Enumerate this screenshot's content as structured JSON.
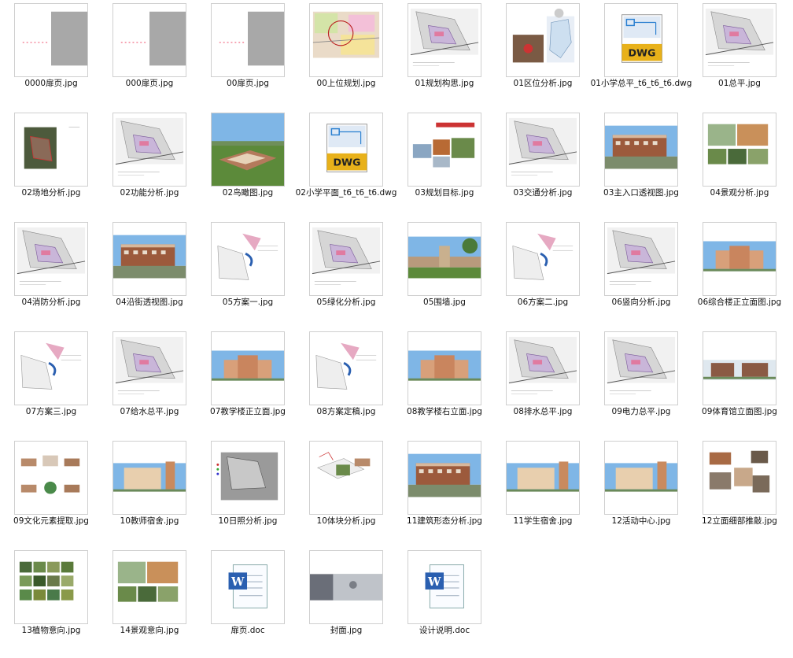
{
  "colors": {
    "thumb_border": "#cfcfcf",
    "gray_block": "#a8a8a8",
    "dwg_gold": "#e8b11a",
    "word_blue": "#2a5fb0",
    "sky": "#7fb6e6",
    "brick": "#9c5a3c",
    "grass": "#5c8a3a"
  },
  "files": [
    {
      "label": "0000扉页.jpg",
      "icon": "title-page-thumb"
    },
    {
      "label": "000扉页.jpg",
      "icon": "title-page-thumb"
    },
    {
      "label": "00扉页.jpg",
      "icon": "title-page-thumb"
    },
    {
      "label": "00上位规划.jpg",
      "icon": "planning-map-thumb"
    },
    {
      "label": "01规划构思.jpg",
      "icon": "site-plan-thumb"
    },
    {
      "label": "01区位分析.jpg",
      "icon": "location-map-thumb"
    },
    {
      "label": "01小学总平_t6_t6_t6.dwg",
      "icon": "dwg-file-icon"
    },
    {
      "label": "01总平.jpg",
      "icon": "site-plan-thumb"
    },
    {
      "label": "02场地分析.jpg",
      "icon": "aerial-photo-thumb"
    },
    {
      "label": "02功能分析.jpg",
      "icon": "site-plan-thumb"
    },
    {
      "label": "02鸟瞰图.jpg",
      "icon": "birdseye-render-thumb"
    },
    {
      "label": "02小学平面_t6_t6_t6.dwg",
      "icon": "dwg-file-icon"
    },
    {
      "label": "03规划目标.jpg",
      "icon": "photo-collage-thumb"
    },
    {
      "label": "03交通分析.jpg",
      "icon": "site-plan-thumb"
    },
    {
      "label": "03主入口透视图.jpg",
      "icon": "building-render-thumb"
    },
    {
      "label": "04景观分析.jpg",
      "icon": "landscape-collage-thumb"
    },
    {
      "label": "04消防分析.jpg",
      "icon": "site-plan-thumb"
    },
    {
      "label": "04沿街透视图.jpg",
      "icon": "building-render-thumb"
    },
    {
      "label": "05方案一.jpg",
      "icon": "scheme-diagram-thumb"
    },
    {
      "label": "05绿化分析.jpg",
      "icon": "site-plan-thumb"
    },
    {
      "label": "05围墙.jpg",
      "icon": "wall-render-thumb"
    },
    {
      "label": "06方案二.jpg",
      "icon": "scheme-diagram-thumb"
    },
    {
      "label": "06竖向分析.jpg",
      "icon": "site-plan-thumb"
    },
    {
      "label": "06综合楼正立面图.jpg",
      "icon": "elevation-thumb"
    },
    {
      "label": "07方案三.jpg",
      "icon": "scheme-diagram-thumb"
    },
    {
      "label": "07给水总平.jpg",
      "icon": "site-plan-thumb"
    },
    {
      "label": "07教学楼正立面.jpg",
      "icon": "elevation-thumb"
    },
    {
      "label": "08方案定稿.jpg",
      "icon": "scheme-diagram-thumb"
    },
    {
      "label": "08教学楼右立面.jpg",
      "icon": "elevation-thumb"
    },
    {
      "label": "08排水总平.jpg",
      "icon": "site-plan-thumb"
    },
    {
      "label": "09电力总平.jpg",
      "icon": "site-plan-thumb"
    },
    {
      "label": "09体育馆立面图.jpg",
      "icon": "gym-elevation-thumb"
    },
    {
      "label": "09文化元素提取.jpg",
      "icon": "culture-diagram-thumb"
    },
    {
      "label": "10教师宿舍.jpg",
      "icon": "dorm-elevation-thumb"
    },
    {
      "label": "10日照分析.jpg",
      "icon": "sunlight-analysis-thumb"
    },
    {
      "label": "10体块分析.jpg",
      "icon": "massing-diagram-thumb"
    },
    {
      "label": "11建筑形态分析.jpg",
      "icon": "building-render-thumb"
    },
    {
      "label": "11学生宿舍.jpg",
      "icon": "dorm-elevation-thumb"
    },
    {
      "label": "12活动中心.jpg",
      "icon": "dorm-elevation-thumb"
    },
    {
      "label": "12立面细部推敲.jpg",
      "icon": "detail-collage-thumb"
    },
    {
      "label": "13植物意向.jpg",
      "icon": "plant-collage-thumb"
    },
    {
      "label": "14景观意向.jpg",
      "icon": "landscape-collage-thumb"
    },
    {
      "label": "扉页.doc",
      "icon": "word-doc-icon"
    },
    {
      "label": "封面.jpg",
      "icon": "cover-thumb"
    },
    {
      "label": "设计说明.doc",
      "icon": "word-doc-icon"
    }
  ]
}
